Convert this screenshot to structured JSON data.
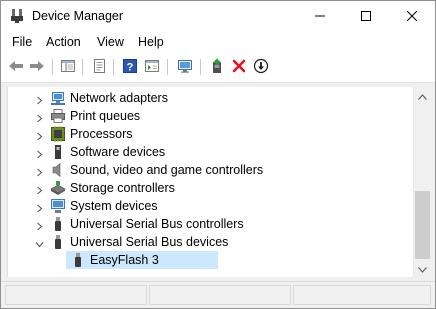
{
  "window": {
    "title": "Device Manager",
    "controls": {
      "minimize": "minimize",
      "maximize": "maximize",
      "close": "close"
    }
  },
  "menu": {
    "items": [
      {
        "label": "File"
      },
      {
        "label": "Action"
      },
      {
        "label": "View"
      },
      {
        "label": "Help"
      }
    ]
  },
  "toolbar": {
    "buttons": [
      {
        "icon": "back-arrow-icon"
      },
      {
        "icon": "forward-arrow-icon"
      },
      {
        "icon": "show-hide-console-tree-icon"
      },
      {
        "icon": "properties-icon"
      },
      {
        "icon": "help-icon"
      },
      {
        "icon": "action-pane-icon"
      },
      {
        "icon": "scan-hardware-changes-icon"
      },
      {
        "icon": "update-driver-icon"
      },
      {
        "icon": "uninstall-device-icon"
      },
      {
        "icon": "disable-device-icon"
      }
    ]
  },
  "tree": {
    "rows": [
      {
        "label": "Network adapters",
        "icon": "network-adapter-icon",
        "expanded": false
      },
      {
        "label": "Print queues",
        "icon": "printer-icon",
        "expanded": false
      },
      {
        "label": "Processors",
        "icon": "processor-icon",
        "expanded": false
      },
      {
        "label": "Software devices",
        "icon": "software-device-icon",
        "expanded": false
      },
      {
        "label": "Sound, video and game controllers",
        "icon": "speaker-icon",
        "expanded": false
      },
      {
        "label": "Storage controllers",
        "icon": "storage-controller-icon",
        "expanded": false
      },
      {
        "label": "System devices",
        "icon": "system-devices-icon",
        "expanded": false
      },
      {
        "label": "Universal Serial Bus controllers",
        "icon": "usb-icon",
        "expanded": false
      },
      {
        "label": "Universal Serial Bus devices",
        "icon": "usb-icon",
        "expanded": true
      },
      {
        "label": "EasyFlash 3",
        "icon": "usb-device-icon",
        "child": true,
        "selected": true
      }
    ]
  },
  "colors": {
    "selection": "#cce8ff",
    "uninstall_red": "#e81123",
    "accent_blue": "#1e6fd9"
  }
}
